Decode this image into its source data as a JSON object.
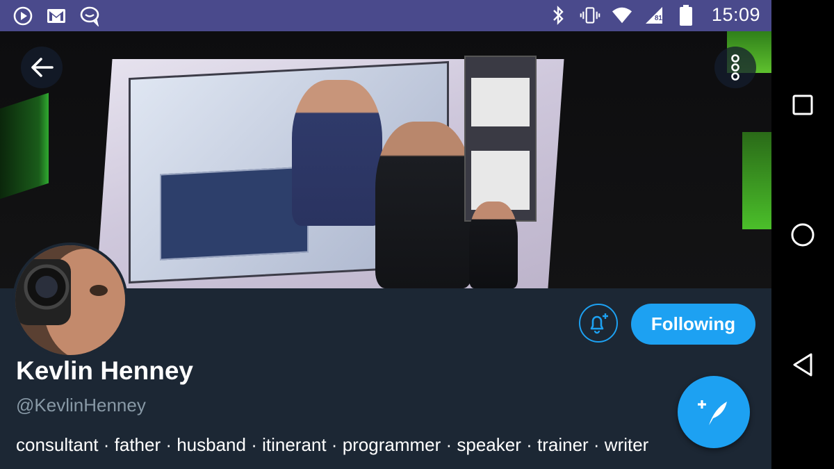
{
  "status_bar": {
    "time": "15:09",
    "battery_level": "81",
    "left_icons": [
      "play-circle-icon",
      "gmail-icon",
      "chat-bubble-icon"
    ],
    "right_icons": [
      "bluetooth-icon",
      "vibrate-icon",
      "wifi-icon",
      "cell-signal-icon",
      "battery-icon"
    ]
  },
  "profile": {
    "name": "Kevlin Henney",
    "handle": "@KevlinHenney",
    "bio": "consultant · father · husband · itinerant · programmer · speaker · trainer · writer",
    "follow_label": "Following"
  },
  "colors": {
    "status_bar": "#4a4a8c",
    "panel_bg": "#1c2734",
    "accent": "#1da1f2",
    "handle_text": "#8899a6"
  },
  "icons": {
    "back": "back-arrow-icon",
    "more": "more-vertical-icon",
    "notify": "bell-plus-icon",
    "compose": "compose-tweet-icon",
    "nav": [
      "recent-apps-icon",
      "home-icon",
      "back-icon"
    ]
  }
}
